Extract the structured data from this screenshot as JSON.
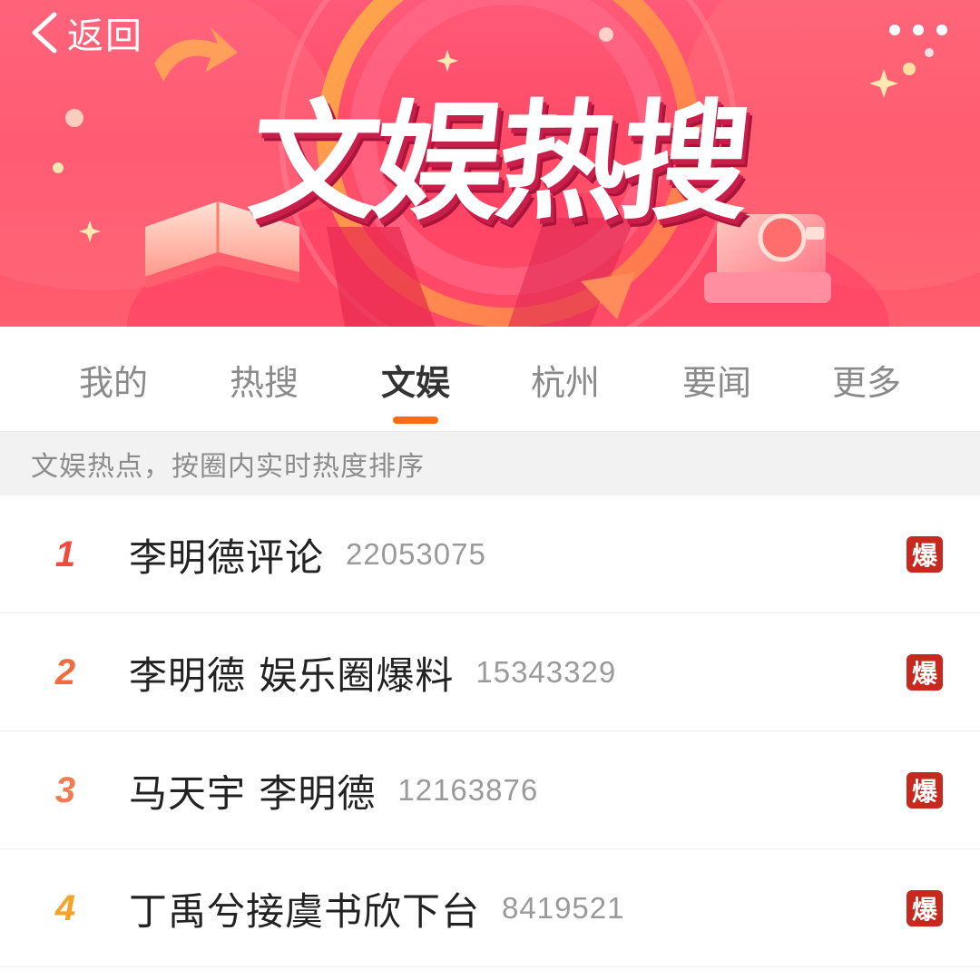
{
  "header": {
    "back_label": "返回",
    "back_icon": "chevron-left-icon",
    "more_icon": "more-dots-icon",
    "banner_title": "文娱热搜"
  },
  "tabs": [
    {
      "label": "我的",
      "active": false
    },
    {
      "label": "热搜",
      "active": false
    },
    {
      "label": "文娱",
      "active": true
    },
    {
      "label": "杭州",
      "active": false
    },
    {
      "label": "要闻",
      "active": false
    },
    {
      "label": "更多",
      "active": false
    }
  ],
  "subheader": "文娱热点，按圈内实时热度排序",
  "items": [
    {
      "rank": "1",
      "title": "李明德评论",
      "count": "22053075",
      "badge": "爆"
    },
    {
      "rank": "2",
      "title": "李明德 娱乐圈爆料",
      "count": "15343329",
      "badge": "爆"
    },
    {
      "rank": "3",
      "title": "马天宇 李明德",
      "count": "12163876",
      "badge": "爆"
    },
    {
      "rank": "4",
      "title": "丁禹兮接虞书欣下台",
      "count": "8419521",
      "badge": "爆"
    }
  ],
  "colors": {
    "banner": "#ff4a66",
    "tab_indicator": "#ff6a14",
    "badge": "#c8291f",
    "rank_1": "#f24a3d",
    "rank_4": "#f5a327"
  }
}
